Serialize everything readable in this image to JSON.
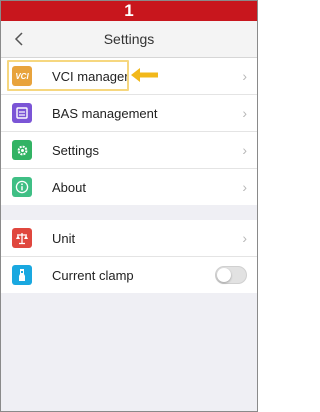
{
  "step": {
    "number": "1"
  },
  "nav": {
    "back_icon": "chevron-left-icon",
    "title": "Settings"
  },
  "groups": [
    {
      "items": [
        {
          "label": "VCI manager",
          "icon": "vci-icon",
          "icon_text": "VCI",
          "color": "#e8a33c"
        },
        {
          "label": "BAS management",
          "icon": "bas-icon",
          "color": "#7b55d6"
        },
        {
          "label": "Settings",
          "icon": "gear-icon",
          "color": "#32b364"
        },
        {
          "label": "About",
          "icon": "info-icon",
          "color": "#3fbf85"
        }
      ]
    },
    {
      "items": [
        {
          "label": "Unit",
          "icon": "scale-icon",
          "color": "#e0473e"
        },
        {
          "label": "Current clamp",
          "icon": "clamp-icon",
          "color": "#1aa8e0",
          "toggle": false
        }
      ]
    }
  ],
  "colors": {
    "banner": "#c8161d",
    "highlight": "#f6d77f",
    "arrow": "#f2b81a"
  }
}
